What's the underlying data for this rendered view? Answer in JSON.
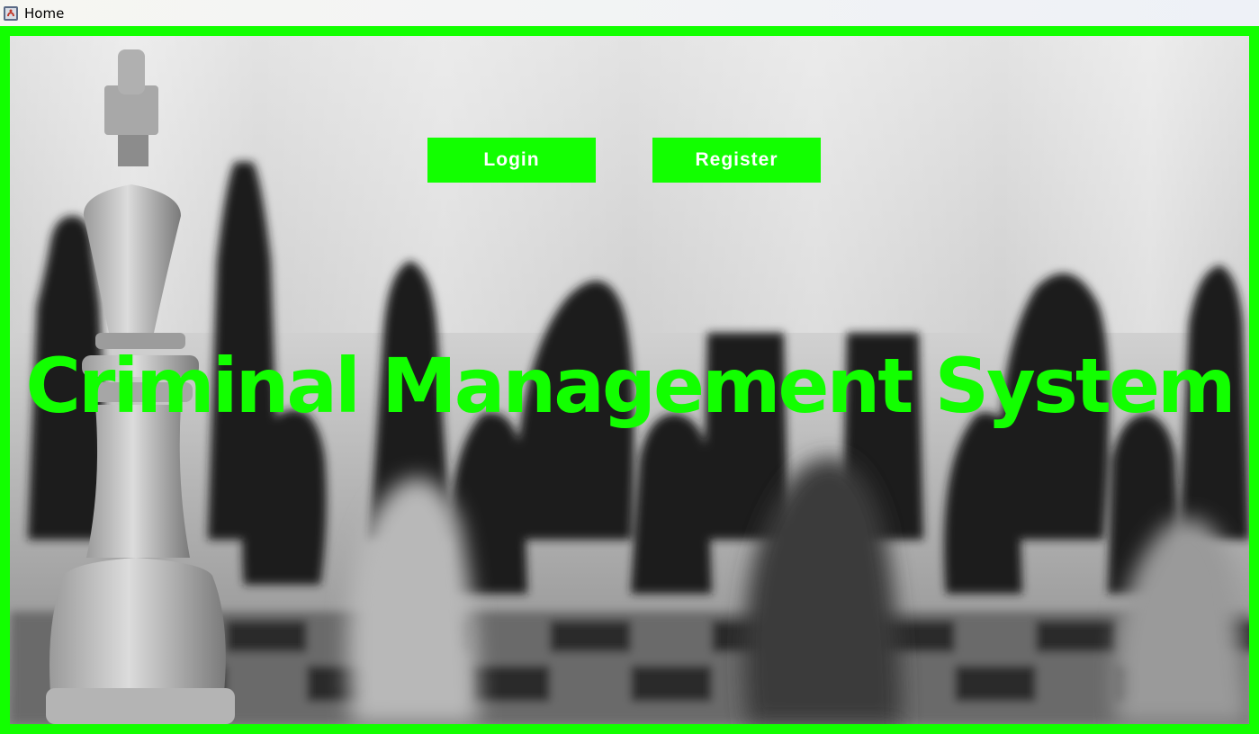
{
  "window": {
    "title": "Home",
    "icon": "java-app-icon"
  },
  "colors": {
    "accent": "#12ff00",
    "button_text": "#ffffff"
  },
  "background": {
    "image": "chess-pieces-photo"
  },
  "actions": {
    "login_label": "Login",
    "register_label": "Register"
  },
  "headline": "Criminal Management System"
}
